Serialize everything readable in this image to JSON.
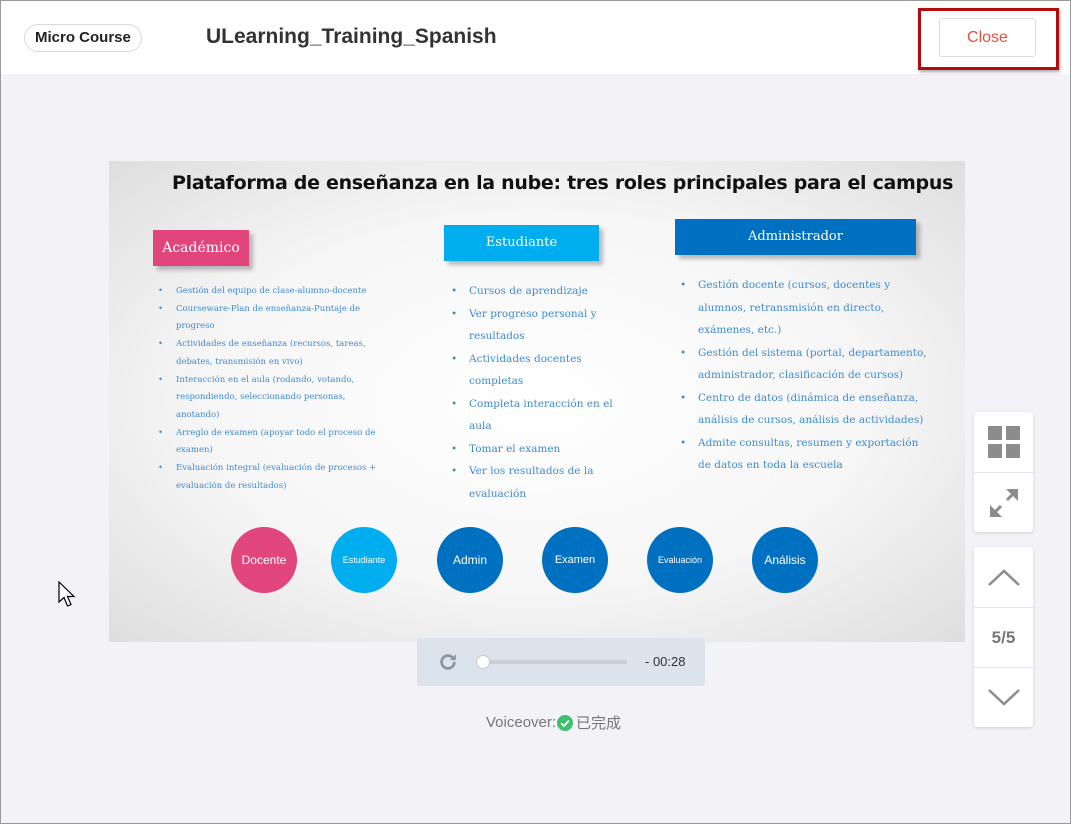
{
  "header": {
    "badge": "Micro Course",
    "title": "ULearning_Training_Spanish",
    "close_label": "Close"
  },
  "slide": {
    "title": "Plataforma de enseñanza en la nube: tres roles principales para el campus",
    "roles": {
      "academic": {
        "heading": "Académico",
        "items": [
          "Gestión del equipo de clase-alumno-docente",
          "Courseware-Plan de enseñanza-Puntaje de progreso",
          "Actividades de enseñanza (recursos, tareas, debates, transmisión en vivo)",
          "Interacción en el aula (rodando, votando, respondiendo, seleccionando personas, anotando)",
          "Arreglo de examen (apoyar todo el proceso de examen)",
          "Evaluación integral (evaluación de procesos + evaluación de resultados)"
        ]
      },
      "student": {
        "heading": "Estudiante",
        "items": [
          "Cursos de aprendizaje",
          "Ver progreso personal y resultados",
          "Actividades docentes completas",
          "Completa interacción en el aula",
          "Tomar el examen",
          "Ver los resultados de la evaluación"
        ]
      },
      "admin": {
        "heading": "Administrador",
        "items": [
          "Gestión docente (cursos, docentes y alumnos, retransmisión en directo, exámenes, etc.)",
          "Gestión del sistema (portal, departamento, administrador, clasificación de cursos)",
          "Centro de datos (dinámica de enseñanza, análisis de cursos, análisis de actividades)",
          "Admite consultas, resumen y exportación de datos en toda la escuela"
        ]
      }
    },
    "circles": [
      {
        "label": "Docente",
        "color": "#e0457b"
      },
      {
        "label": "Estudiante",
        "color": "#00adef"
      },
      {
        "label": "Admin",
        "color": "#0070c0"
      },
      {
        "label": "Examen",
        "color": "#0070c0"
      },
      {
        "label": "Evaluación",
        "color": "#0070c0"
      },
      {
        "label": "Análisis",
        "color": "#0070c0"
      }
    ]
  },
  "player": {
    "time_remaining": "- 00:28",
    "progress": 0.0
  },
  "voiceover": {
    "label": "Voiceover:",
    "status": "已完成"
  },
  "toolbar": {
    "page_indicator": "5/5",
    "icons": [
      "grid-icon",
      "expand-icon",
      "chevron-up-icon",
      "chevron-down-icon"
    ]
  },
  "colors": {
    "close_text": "#e2513c",
    "highlight_border": "#b20d0d",
    "academic": "#e0457b",
    "student": "#00adef",
    "admin": "#0070c0",
    "check_green": "#3cbf6e"
  }
}
